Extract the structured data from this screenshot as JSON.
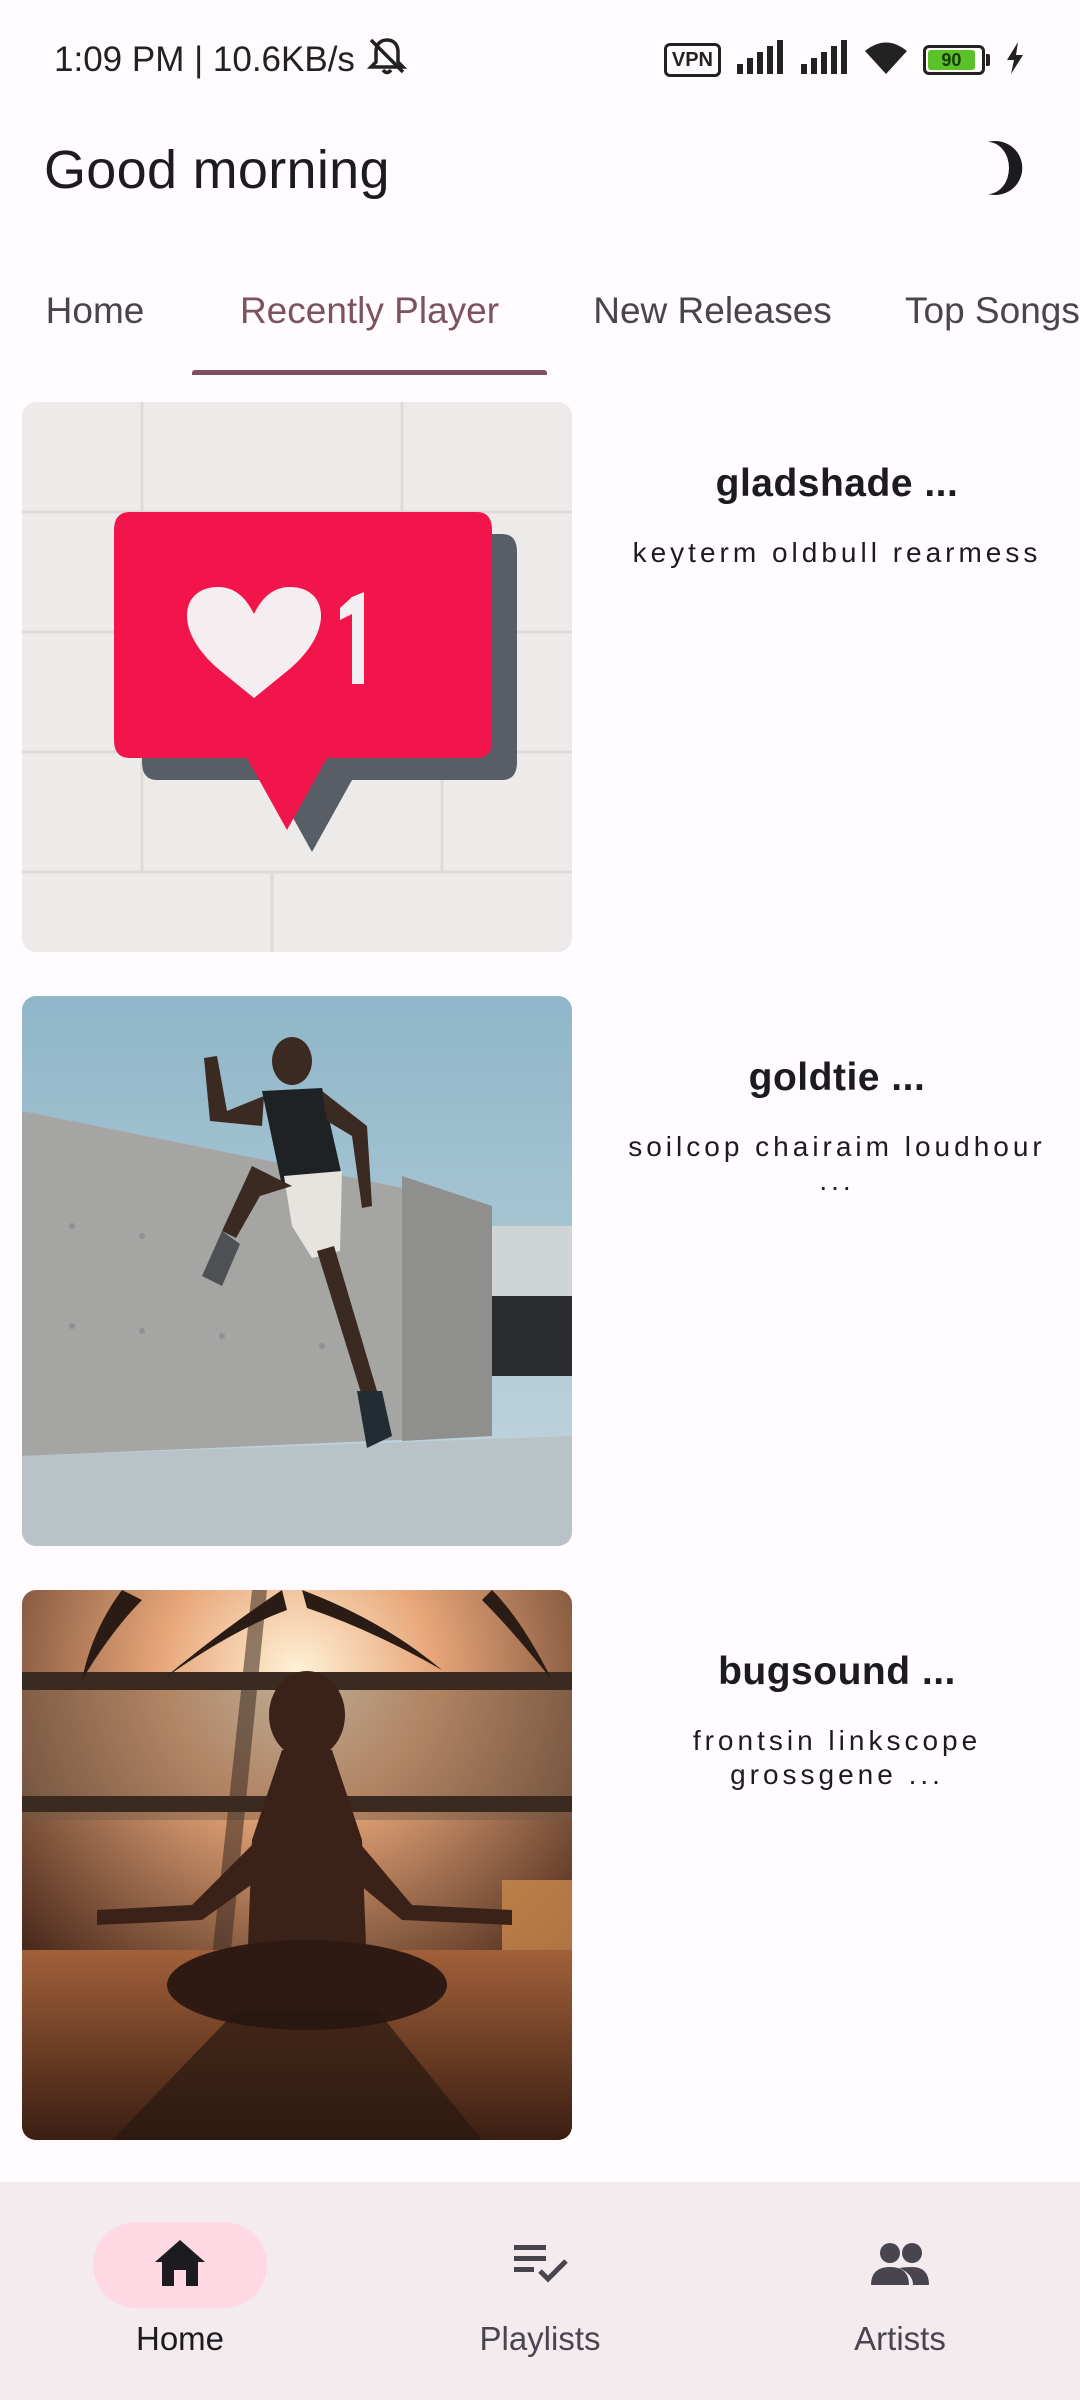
{
  "status_bar": {
    "time_speed": "1:09 PM | 10.6KB/s",
    "vpn": "VPN",
    "battery": "90",
    "icons": [
      "mute-icon",
      "signal-icon",
      "signal-icon",
      "wifi-icon",
      "charging-icon"
    ]
  },
  "header": {
    "greeting": "Good morning",
    "theme_icon": "moon-icon"
  },
  "tabs": [
    {
      "label": "Home",
      "active": false
    },
    {
      "label": "Recently Player",
      "active": true
    },
    {
      "label": "New Releases",
      "active": false
    },
    {
      "label": "Top Songs",
      "active": false
    }
  ],
  "items": [
    {
      "title": "gladshade ...",
      "subtitle": "keyterm oldbull rearmess",
      "image": "red-heart-like-graffiti"
    },
    {
      "title": "goldtie ...",
      "subtitle": "soilcop chairaim loudhour ...",
      "image": "athlete-jumping"
    },
    {
      "title": "bugsound ...",
      "subtitle": "frontsin linkscope grossgene ...",
      "image": "meditation-sunset"
    }
  ],
  "bottom_nav": [
    {
      "label": "Home",
      "icon": "home-icon",
      "active": true
    },
    {
      "label": "Playlists",
      "icon": "playlist-check-icon",
      "active": false
    },
    {
      "label": "Artists",
      "icon": "people-icon",
      "active": false
    }
  ],
  "colors": {
    "background": "#fffbfe",
    "accent": "#7d5260",
    "nav_background": "#f4ebef",
    "nav_active_pill": "#ffd8e4"
  }
}
